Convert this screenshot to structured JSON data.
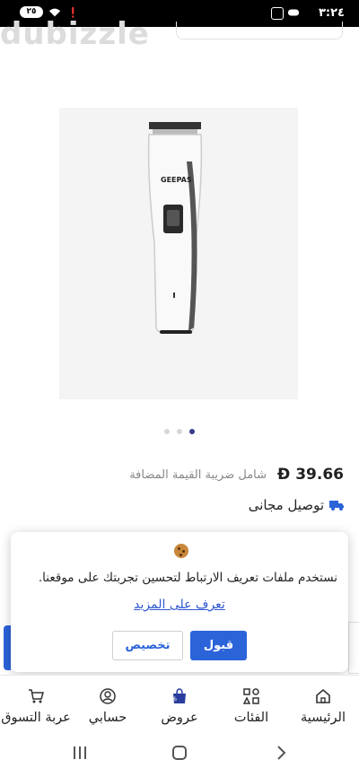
{
  "status_bar": {
    "time": "٣:٢٤",
    "battery": "٢٥"
  },
  "header": {
    "watermark": "dubizzle"
  },
  "product": {
    "image_alt": "GEEPAS hair trimmer",
    "brand_on_device": "GEEPAS",
    "carousel": {
      "count": 3,
      "active_index": 2
    }
  },
  "price": {
    "currency_symbol": "Đ",
    "amount": "39.66",
    "vat_note": "شامل ضريبة القيمة المضافة"
  },
  "delivery": {
    "label": "توصيل مجانى"
  },
  "cookie_dialog": {
    "message": "نستخدم ملفات تعريف الارتباط لتحسين تجربتك على موقعنا.",
    "learn_more": "تعرف على المزيد",
    "accept_label": "قبول",
    "customize_label": "تخصيص"
  },
  "bottom_nav": {
    "items": [
      {
        "label": "الرئيسية",
        "icon": "home-icon"
      },
      {
        "label": "الفئات",
        "icon": "categories-icon"
      },
      {
        "label": "عروض",
        "icon": "offers-bag-icon"
      },
      {
        "label": "حسابي",
        "icon": "account-icon"
      },
      {
        "label": "عربة التسوق",
        "icon": "cart-icon"
      }
    ]
  },
  "colors": {
    "primary": "#2b63d9",
    "status_bar": "#000000",
    "carousel_active": "#3a3a8c"
  }
}
